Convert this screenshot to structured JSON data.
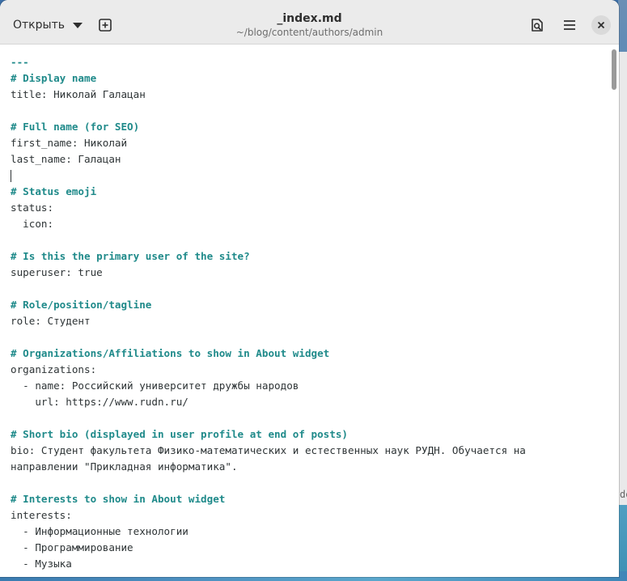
{
  "header": {
    "open_label": "Открыть",
    "title": "_index.md",
    "subtitle": "~/blog/content/authors/admin"
  },
  "icons": {
    "open_menu": "chevron-down-icon",
    "new_tab": "new-tab-icon",
    "find": "document-search-icon",
    "menu": "hamburger-menu-icon",
    "close": "close-icon"
  },
  "desktop": {
    "edge_text": "de"
  },
  "editor": {
    "lines": [
      "---",
      "# Display name",
      "title: Николай Галацан",
      "",
      "# Full name (for SEO)",
      "first_name: Николай",
      "last_name: Галацан",
      "",
      "# Status emoji",
      "status:",
      "  icon:",
      "",
      "# Is this the primary user of the site?",
      "superuser: true",
      "",
      "# Role/position/tagline",
      "role: Студент",
      "",
      "# Organizations/Affiliations to show in About widget",
      "organizations:",
      "  - name: Российский университет дружбы народов",
      "    url: https://www.rudn.ru/",
      "",
      "# Short bio (displayed in user profile at end of posts)",
      "bio: Студент факультета Физико-математических и естественных наук РУДН. Обучается на",
      "направлении \"Прикладная информатика\".",
      "",
      "# Interests to show in About widget",
      "interests:",
      "  - Информационные технологии",
      "  - Программирование",
      "  - Музыка"
    ]
  },
  "colors": {
    "comment": "#1f8a8a",
    "list_dash": "#e66100",
    "spell_underline": "#d42020",
    "headerbar": "#ebebeb"
  }
}
